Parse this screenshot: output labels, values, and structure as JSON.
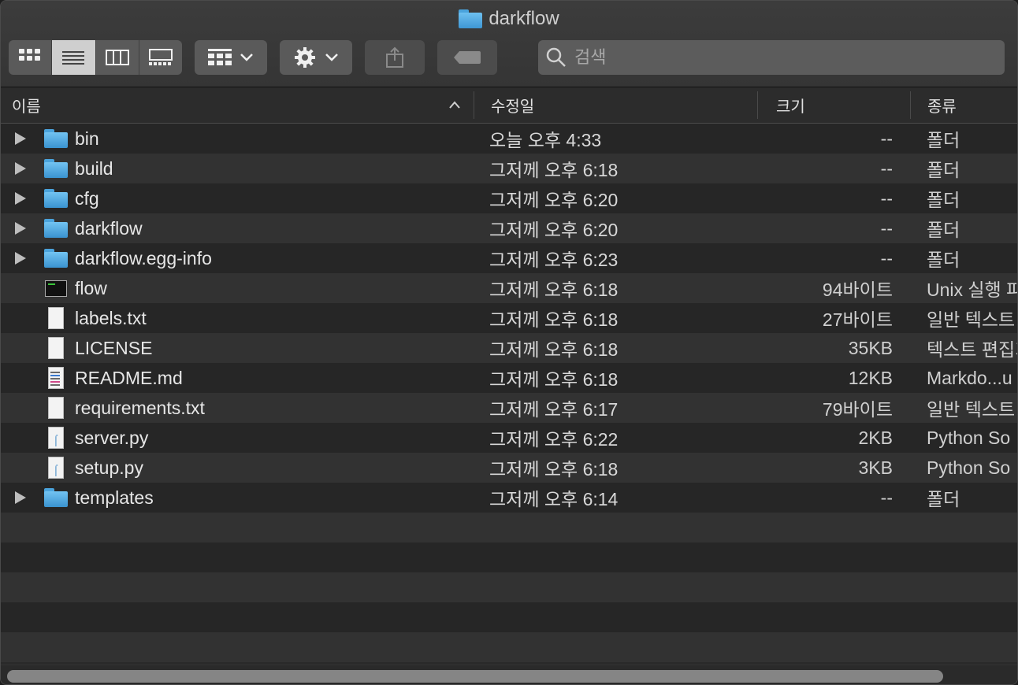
{
  "window": {
    "title": "darkflow"
  },
  "toolbar": {
    "search_placeholder": "검색"
  },
  "columns": {
    "name": "이름",
    "date": "수정일",
    "size": "크기",
    "kind": "종류"
  },
  "files": [
    {
      "name": "bin",
      "date": "오늘 오후 4:33",
      "size": "--",
      "kind": "폴더",
      "type": "folder",
      "icon": "folder-icon"
    },
    {
      "name": "build",
      "date": "그저께 오후 6:18",
      "size": "--",
      "kind": "폴더",
      "type": "folder",
      "icon": "folder-icon"
    },
    {
      "name": "cfg",
      "date": "그저께 오후 6:20",
      "size": "--",
      "kind": "폴더",
      "type": "folder",
      "icon": "folder-icon"
    },
    {
      "name": "darkflow",
      "date": "그저께 오후 6:20",
      "size": "--",
      "kind": "폴더",
      "type": "folder",
      "icon": "folder-icon"
    },
    {
      "name": "darkflow.egg-info",
      "date": "그저께 오후 6:23",
      "size": "--",
      "kind": "폴더",
      "type": "folder",
      "icon": "folder-icon"
    },
    {
      "name": "flow",
      "date": "그저께 오후 6:18",
      "size": "94바이트",
      "kind": "Unix 실행 파",
      "type": "exec",
      "icon": "terminal-icon"
    },
    {
      "name": "labels.txt",
      "date": "그저께 오후 6:18",
      "size": "27바이트",
      "kind": "일반 텍스트 ",
      "type": "doc",
      "icon": "text-file-icon"
    },
    {
      "name": "LICENSE",
      "date": "그저께 오후 6:18",
      "size": "35KB",
      "kind": "텍스트 편집기",
      "type": "doc",
      "icon": "document-icon"
    },
    {
      "name": "README.md",
      "date": "그저께 오후 6:18",
      "size": "12KB",
      "kind": "Markdo...u",
      "type": "md",
      "icon": "markdown-file-icon"
    },
    {
      "name": "requirements.txt",
      "date": "그저께 오후 6:17",
      "size": "79바이트",
      "kind": "일반 텍스트 ",
      "type": "doc",
      "icon": "text-file-icon"
    },
    {
      "name": "server.py",
      "date": "그저께 오후 6:22",
      "size": "2KB",
      "kind": "Python So",
      "type": "py",
      "icon": "python-file-icon"
    },
    {
      "name": "setup.py",
      "date": "그저께 오후 6:18",
      "size": "3KB",
      "kind": "Python So",
      "type": "py",
      "icon": "python-file-icon"
    },
    {
      "name": "templates",
      "date": "그저께 오후 6:14",
      "size": "--",
      "kind": "폴더",
      "type": "folder",
      "icon": "folder-icon"
    }
  ]
}
